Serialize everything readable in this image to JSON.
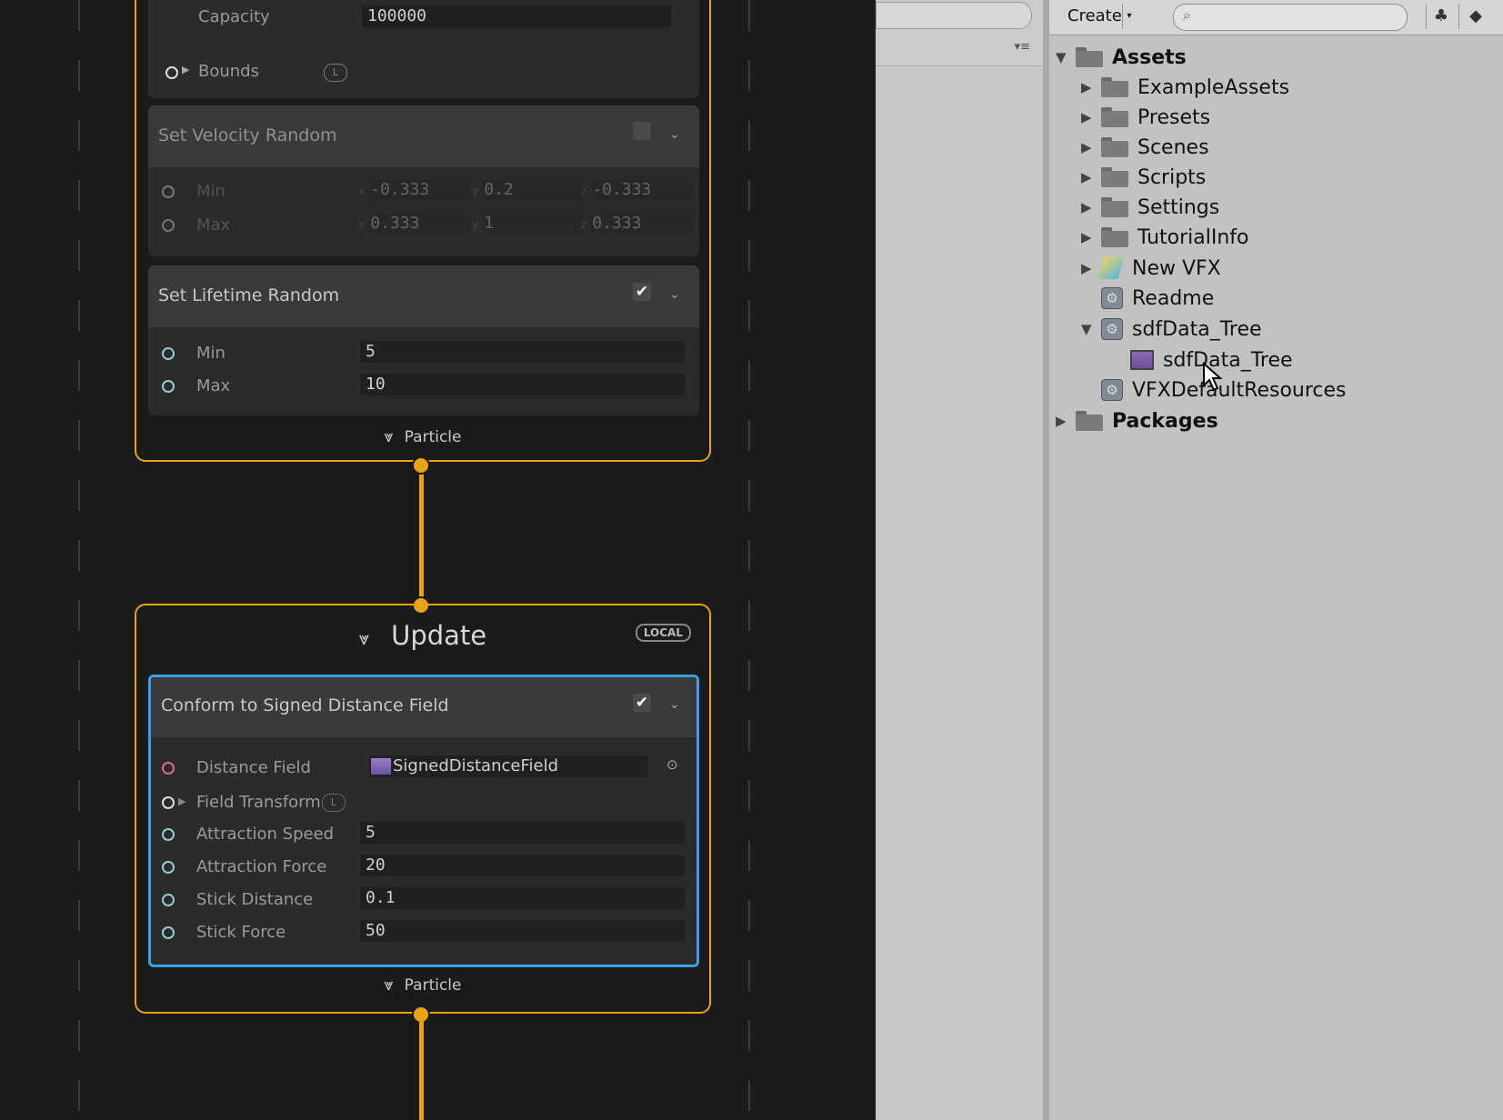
{
  "graph": {
    "init_block": {
      "capacity_label": "Capacity",
      "capacity_value": "100000",
      "bounds_label": "Bounds",
      "bounds_badge": "L"
    },
    "velocity_block": {
      "title": "Set Velocity Random",
      "enabled": false,
      "min_label": "Min",
      "max_label": "Max",
      "axis_labels": [
        "x",
        "y",
        "z"
      ],
      "min": [
        "-0.333",
        "0.2",
        "-0.333"
      ],
      "max": [
        "0.333",
        "1",
        "0.333"
      ]
    },
    "lifetime_block": {
      "title": "Set Lifetime Random",
      "enabled": true,
      "check_glyph": "✔",
      "min_label": "Min",
      "min_value": "5",
      "max_label": "Max",
      "max_value": "10"
    },
    "init_footer": "Particle",
    "update": {
      "title": "Update",
      "badge": "LOCAL",
      "block_title": "Conform to Signed Distance Field",
      "enabled": true,
      "check_glyph": "✔",
      "distance_field_label": "Distance Field",
      "distance_field_value": "SignedDistanceField",
      "field_transform_label": "Field Transform",
      "field_transform_badge": "L",
      "attraction_speed_label": "Attraction Speed",
      "attraction_speed": "5",
      "attraction_force_label": "Attraction Force",
      "attraction_force": "20",
      "stick_distance_label": "Stick Distance",
      "stick_distance": "0.1",
      "stick_force_label": "Stick Force",
      "stick_force": "50",
      "footer": "Particle"
    },
    "colors": {
      "context_border": "#e8a214",
      "selected_border": "#3aa0e8"
    }
  },
  "project": {
    "create_label": "Create",
    "tree": [
      {
        "label": "Assets",
        "bold": true,
        "expanded": true
      },
      {
        "label": "ExampleAssets"
      },
      {
        "label": "Presets"
      },
      {
        "label": "Scenes"
      },
      {
        "label": "Scripts"
      },
      {
        "label": "Settings"
      },
      {
        "label": "TutorialInfo"
      },
      {
        "label": "New VFX"
      },
      {
        "label": "Readme"
      },
      {
        "label": "sdfData_Tree",
        "expanded": true
      },
      {
        "label": "sdfData_Tree"
      },
      {
        "label": "VFXDefaultResources"
      },
      {
        "label": "Packages",
        "bold": true
      }
    ]
  }
}
